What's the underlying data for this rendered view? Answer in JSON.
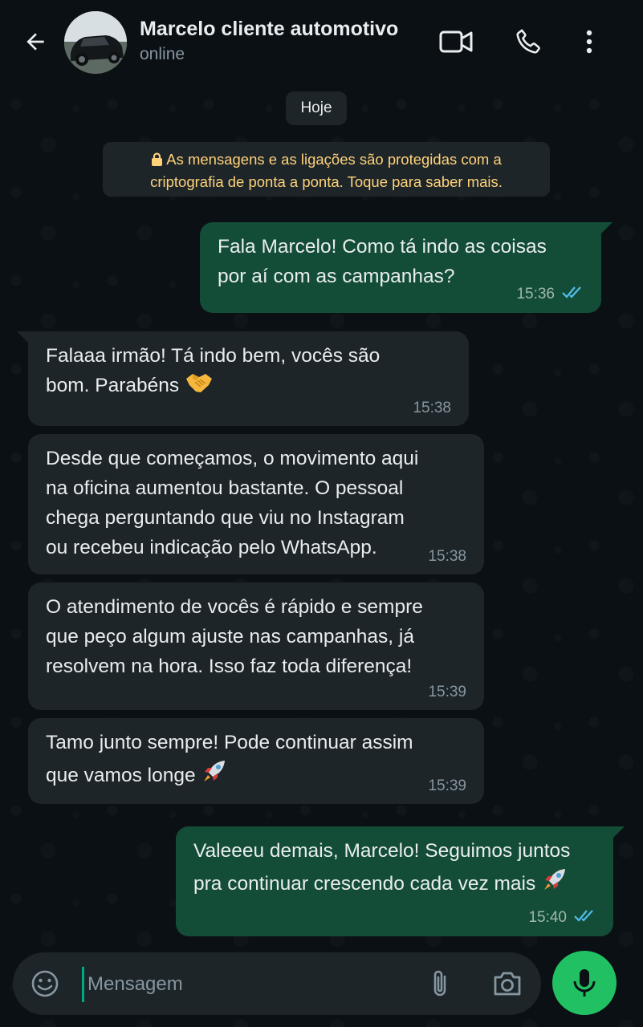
{
  "header": {
    "contact_name": "Marcelo cliente automotivo",
    "status": "online"
  },
  "date_chip": "Hoje",
  "encryption_notice": {
    "line1": "As mensagens e as ligações são protegidas com a",
    "line2": "criptografia de ponta a ponta. Toque para saber mais."
  },
  "messages": [
    {
      "direction": "out",
      "text": "Fala Marcelo! Como tá indo as coisas\npor aí com as campanhas?",
      "time": "15:36",
      "read": true
    },
    {
      "direction": "in",
      "text": "Falaaa irmão! Tá indo bem, vocês são\nbom. Parabéns",
      "emoji": "handshake-emoji",
      "time": "15:38"
    },
    {
      "direction": "in",
      "text": "Desde que começamos, o movimento aqui\nna oficina aumentou bastante. O pessoal\nchega perguntando que viu no Instagram\nou recebeu indicação pelo WhatsApp.",
      "time": "15:38"
    },
    {
      "direction": "in",
      "text": "O atendimento de vocês é rápido e sempre\nque peço algum ajuste nas campanhas, já\nresolvem na hora. Isso faz toda diferença!",
      "time": "15:39"
    },
    {
      "direction": "in",
      "text": "Tamo junto sempre! Pode continuar assim\nque vamos longe",
      "emoji": "rocket-emoji",
      "time": "15:39"
    },
    {
      "direction": "out",
      "text": "Valeeeu demais, Marcelo! Seguimos juntos\npra continuar crescendo cada vez mais",
      "emoji": "rocket-emoji",
      "time": "15:40",
      "read": true
    }
  ],
  "composer": {
    "placeholder": "Mensagem"
  },
  "colors": {
    "background": "#0b1014",
    "incoming_bubble": "#1d2529",
    "outgoing_bubble": "#134d37",
    "read_ticks": "#53bdeb",
    "mic_button": "#21c063",
    "encryption_text": "#ffd279"
  }
}
